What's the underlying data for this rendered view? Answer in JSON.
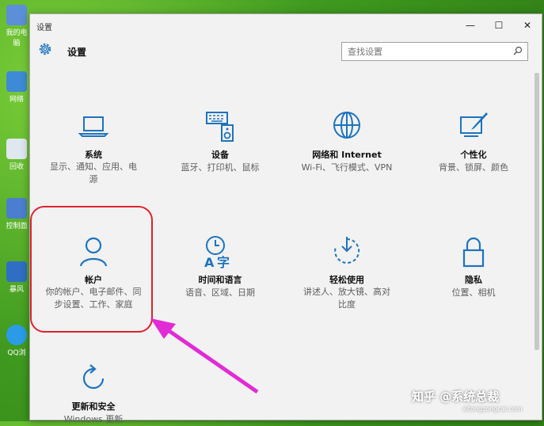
{
  "desktop": {
    "icons": [
      {
        "label": "我的电脑"
      },
      {
        "label": "网络"
      },
      {
        "label": "回收"
      },
      {
        "label": "控制面"
      },
      {
        "label": "暴风"
      },
      {
        "label": "QQ浏"
      }
    ]
  },
  "window": {
    "title": "设置",
    "controls": {
      "minimize": "—",
      "maximize": "☐",
      "close": "✕"
    }
  },
  "header": {
    "title": "设置",
    "search_placeholder": "查找设置"
  },
  "tiles": [
    {
      "name": "系统",
      "desc": "显示、通知、应用、电源",
      "icon": "laptop-icon"
    },
    {
      "name": "设备",
      "desc": "蓝牙、打印机、鼠标",
      "icon": "keyboard-speaker-icon"
    },
    {
      "name": "网络和 Internet",
      "desc": "Wi-Fi、飞行模式、VPN",
      "icon": "globe-icon"
    },
    {
      "name": "个性化",
      "desc": "背景、锁屏、颜色",
      "icon": "paint-monitor-icon"
    },
    {
      "name": "帐户",
      "desc": "你的帐户、电子邮件、同步设置、工作、家庭",
      "icon": "person-icon"
    },
    {
      "name": "时间和语言",
      "desc": "语音、区域、日期",
      "icon": "time-language-icon"
    },
    {
      "name": "轻松使用",
      "desc": "讲述人、放大镜、高对比度",
      "icon": "ease-of-access-icon"
    },
    {
      "name": "隐私",
      "desc": "位置、相机",
      "icon": "lock-icon"
    },
    {
      "name": "更新和安全",
      "desc": "Windows 更新",
      "icon": "refresh-icon"
    }
  ],
  "watermark": {
    "text": "知乎 @系统总裁",
    "sub": "xitongzongcai.com"
  },
  "colors": {
    "accent": "#1e73be",
    "highlight": "#e0222e",
    "arrow": "#e12bd6"
  }
}
